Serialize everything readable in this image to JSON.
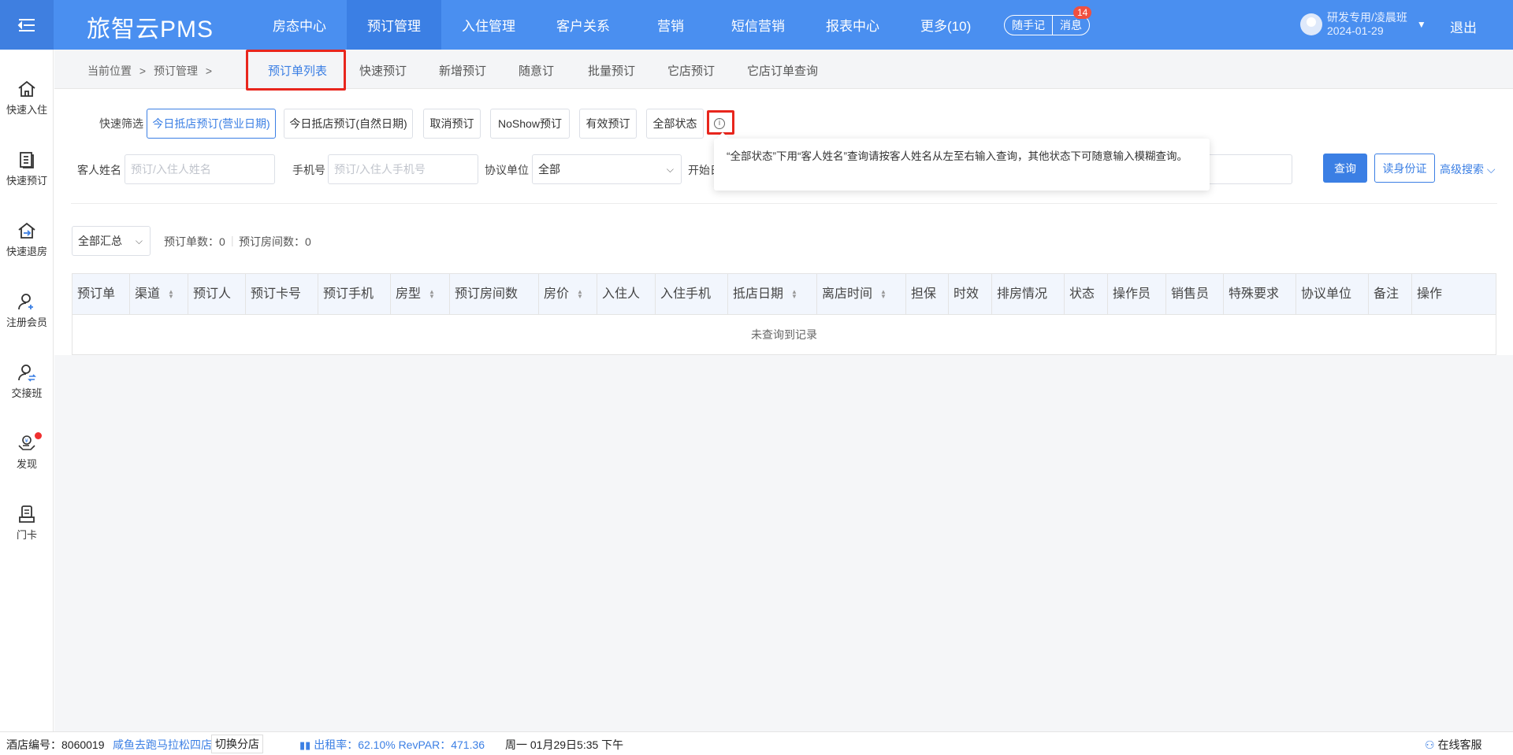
{
  "app": {
    "title": "旅智云PMS"
  },
  "nav": [
    "房态中心",
    "预订管理",
    "入住管理",
    "客户关系",
    "营销",
    "短信营销",
    "报表中心",
    "更多(10)"
  ],
  "quick": {
    "notes": "随手记",
    "messages": "消息",
    "message_count": "14"
  },
  "user": {
    "name": "研发专用/凌晨班",
    "date": "2024-01-29",
    "logout": "退出"
  },
  "sidebar": [
    "快速入住",
    "快速预订",
    "快速退房",
    "注册会员",
    "交接班",
    "发现",
    "门卡"
  ],
  "breadcrumb": {
    "location": "当前位置",
    "sep": ">",
    "section": "预订管理"
  },
  "tabs": [
    "预订单列表",
    "快速预订",
    "新增预订",
    "随意订",
    "批量预订",
    "它店预订",
    "它店订单查询"
  ],
  "filters": {
    "quick_label": "快速筛选",
    "quick_buttons": [
      "今日抵店预订(营业日期)",
      "今日抵店预订(自然日期)",
      "取消预订",
      "NoShow预订",
      "有效预订",
      "全部状态"
    ],
    "tooltip": "“全部状态”下用“客人姓名”查询请按客人姓名从左至右输入查询，其他状态下可随意输入模糊查询。",
    "guest_label": "客人姓名",
    "guest_placeholder": "预订/入住人姓名",
    "phone_label": "手机号",
    "phone_placeholder": "预订/入住人手机号",
    "company_label": "协议单位",
    "company_value": "全部",
    "start_label": "开始日",
    "search": "查询",
    "read_id": "读身份证",
    "advanced": "高级搜索"
  },
  "summary": {
    "select": "全部汇总",
    "orders_label": "预订单数：0",
    "rooms_label": "预订房间数：0"
  },
  "table": {
    "columns": [
      "预订单",
      "渠道",
      "预订人",
      "预订卡号",
      "预订手机",
      "房型",
      "预订房间数",
      "房价",
      "入住人",
      "入住手机",
      "抵店日期",
      "离店时间",
      "担保",
      "时效",
      "排房情况",
      "状态",
      "操作员",
      "销售员",
      "特殊要求",
      "协议单位",
      "备注",
      "操作"
    ],
    "empty": "未查询到记录"
  },
  "footer": {
    "hotel_label": "酒店编号：8060019",
    "hotel_name": "咸鱼去跑马拉松四店",
    "switch": "切换分店",
    "occupancy": "出租率：62.10% RevPAR：471.36",
    "datetime": "周一 01月29日5:35 下午",
    "support": "在线客服"
  }
}
